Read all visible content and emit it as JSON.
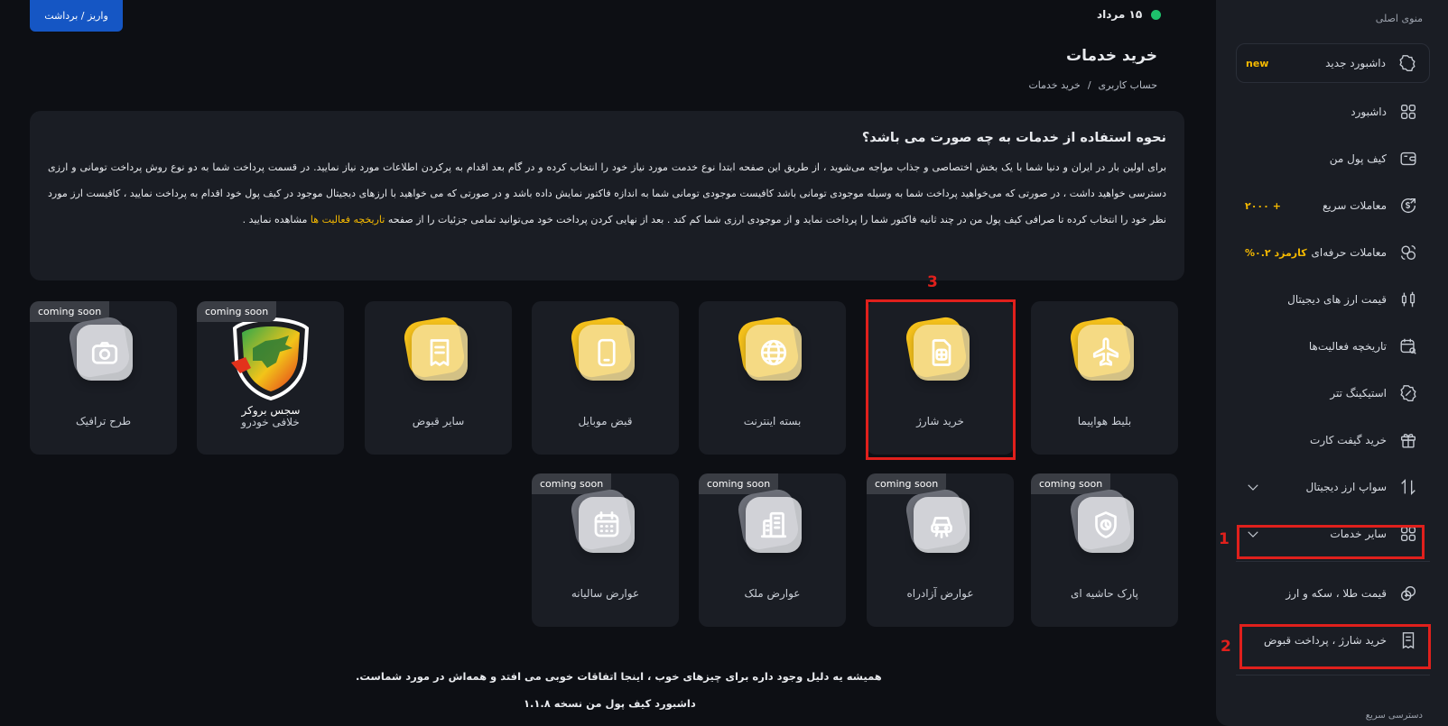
{
  "header": {
    "deposit_label": "واریز / برداشت",
    "date": "۱۵ مرداد",
    "page_title": "خرید خدمات",
    "breadcrumb": [
      "حساب کاربری",
      "/",
      "خرید خدمات"
    ]
  },
  "info": {
    "title": "نحوه استفاده از خدمات به چه صورت می باشد؟",
    "body": "برای اولین بار در ایران و دنیا شما با یک بخش اختصاصی و جذاب مواجه می‌شوید ، از طریق این صفحه ابتدا نوع خدمت مورد نیاز خود را انتخاب کرده و در گام بعد اقدام به پرکردن اطلاعات مورد نیاز نمایید. در قسمت پرداخت شما به دو نوع روش پرداخت تومانی و ارزی دسترسی خواهید داشت ، در صورتی که می‌خواهید پرداخت شما به وسیله موجودی تومانی باشد کافیست موجودی تومانی شما به اندازه فاکتور نمایش داده باشد و در صورتی که می خواهید با ارزهای دیجیتال موجود در کیف پول خود اقدام به پرداخت نمایید ، کافیست ارز مورد نظر خود را انتخاب کرده تا صرافی کیف پول من در چند ثانیه فاکتور شما را پرداخت نماید و از موجودی ارزی شما کم کند . بعد از نهایی کردن پرداخت خود می‌توانید تمامی جزئیات را از صفحه",
    "link": "تاریخچه فعالیت ها",
    "tail": "مشاهده نمایید ."
  },
  "services": [
    {
      "label": "بلیط هواپیما",
      "badge": "",
      "icon": "airplane-icon"
    },
    {
      "label": "خرید شارژ",
      "badge": "",
      "icon": "sim-card-icon"
    },
    {
      "label": "بسته اینترنت",
      "badge": "",
      "icon": "globe-icon"
    },
    {
      "label": "قبض موبایل",
      "badge": "",
      "icon": "mobile-icon"
    },
    {
      "label": "سایر قبوض",
      "badge": "",
      "icon": "receipt-icon"
    },
    {
      "label": "خلافی خودرو",
      "badge": "coming soon",
      "icon": "broker-logo",
      "logo_text": "سجس بروکر"
    },
    {
      "label": "طرح ترافیک",
      "badge": "coming soon",
      "icon": "camera-icon"
    },
    {
      "label": "پارک حاشیه ای",
      "badge": "coming soon",
      "icon": "parking-shield-icon"
    },
    {
      "label": "عوارض آزادراه",
      "badge": "coming soon",
      "icon": "car-road-icon"
    },
    {
      "label": "عوارض ملک",
      "badge": "coming soon",
      "icon": "building-icon"
    },
    {
      "label": "عوارض سالیانه",
      "badge": "coming soon",
      "icon": "calendar-icon"
    }
  ],
  "sidebar": {
    "title": "منوی اصلی",
    "items": [
      {
        "label": "داشبورد جدید",
        "extra": "new",
        "icon": "badge-star-icon"
      },
      {
        "label": "داشبورد",
        "extra": "",
        "icon": "grid-icon"
      },
      {
        "label": "کیف پول من",
        "extra": "",
        "icon": "wallet-icon"
      },
      {
        "label": "معاملات سریع",
        "extra": "+ ۲۰۰۰",
        "icon": "dollar-arrow-icon"
      },
      {
        "label": "معاملات حرفه‌ای",
        "extra": "کارمزد ۰.۲%",
        "icon": "exchange-icon"
      },
      {
        "label": "قیمت ارز های دیجیتال",
        "extra": "",
        "icon": "candles-icon"
      },
      {
        "label": "تاریخچه فعالیت‌ها",
        "extra": "",
        "icon": "calendar-search-icon"
      },
      {
        "label": "استیکینگ تتر",
        "extra": "",
        "icon": "percent-badge-icon"
      },
      {
        "label": "خرید گیفت کارت",
        "extra": "",
        "icon": "gift-icon"
      },
      {
        "label": "سواپ ارز دیجیتال",
        "extra": "",
        "icon": "swap-icon"
      },
      {
        "label": "سایر خدمات",
        "extra": "",
        "icon": "grid-icon"
      },
      {
        "label": "قیمت طلا ، سکه و ارز",
        "extra": "",
        "icon": "coins-icon"
      },
      {
        "label": "خرید شارژ ، پرداخت قبوض",
        "extra": "",
        "icon": "receipt-icon"
      }
    ],
    "footer": "دسترسی سریع"
  },
  "annotations": [
    "1",
    "2",
    "3"
  ],
  "footer": {
    "line1": "همیشه یه دلیل وجود داره برای چیزهای خوب ، اینجا اتفاقات خوبی می افتد و همه‌اش در مورد شماست.",
    "line2": "داشبورد کیف پول من نسخه ۱.۱.۸"
  },
  "colors": {
    "accent_yellow": "#f6c21c",
    "primary_blue": "#1556c4",
    "annotation_red": "#e0201c",
    "status_green": "#1ec26c"
  }
}
